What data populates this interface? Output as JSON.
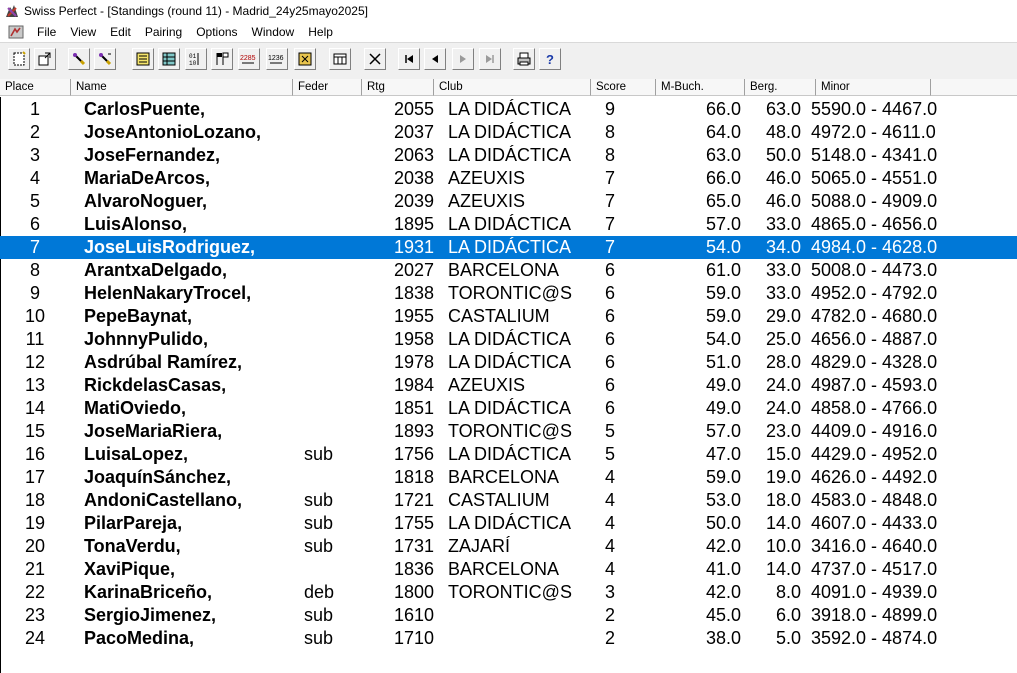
{
  "window": {
    "title": "Swiss Perfect - [Standings  (round 11) - Madrid_24y25mayo2025]"
  },
  "menu": {
    "items": [
      "File",
      "View",
      "Edit",
      "Pairing",
      "Options",
      "Window",
      "Help"
    ]
  },
  "toolbar": {
    "buttons": [
      "new-document-icon",
      "open-document-icon",
      "pairing-tool-icon",
      "pairing-alt-icon",
      "notes-icon",
      "standings-icon",
      "binary-crosstable-icon",
      "flags-icon",
      "numbers-2285-icon",
      "numbers-1236-icon",
      "export-icon",
      "table-icon",
      "cancel-icon",
      "first-record-icon",
      "previous-record-icon",
      "next-record-icon",
      "last-record-icon",
      "print-icon",
      "help-icon"
    ],
    "labels": {
      "n2285": "2285",
      "n1236": "1236"
    }
  },
  "colors": {
    "selection": "#0078d7",
    "toolbar": "#f0f0f0"
  },
  "standings": {
    "columns": [
      "Place",
      "Name",
      "Feder",
      "Rtg",
      "Club",
      "Score",
      "M-Buch.",
      "Berg.",
      "Minor"
    ],
    "selected_row": 6,
    "rows": [
      {
        "place": "1",
        "name": "CarlosPuente,",
        "feder": "",
        "rtg": "2055",
        "club": "LA DIDÁCTICA",
        "score": "9",
        "mbuch": "66.0",
        "berg": "63.0",
        "minor": "5590.0  -  4467.0"
      },
      {
        "place": "2",
        "name": "JoseAntonioLozano,",
        "feder": "",
        "rtg": "2037",
        "club": "LA DIDÁCTICA",
        "score": "8",
        "mbuch": "64.0",
        "berg": "48.0",
        "minor": "4972.0  -  4611.0"
      },
      {
        "place": "3",
        "name": "JoseFernandez,",
        "feder": "",
        "rtg": "2063",
        "club": "LA DIDÁCTICA",
        "score": "8",
        "mbuch": "63.0",
        "berg": "50.0",
        "minor": "5148.0  -  4341.0"
      },
      {
        "place": "4",
        "name": "MariaDeArcos,",
        "feder": "",
        "rtg": "2038",
        "club": "AZEUXIS",
        "score": "7",
        "mbuch": "66.0",
        "berg": "46.0",
        "minor": "5065.0  -  4551.0"
      },
      {
        "place": "5",
        "name": "AlvaroNoguer,",
        "feder": "",
        "rtg": "2039",
        "club": "AZEUXIS",
        "score": "7",
        "mbuch": "65.0",
        "berg": "46.0",
        "minor": "5088.0  -  4909.0"
      },
      {
        "place": "6",
        "name": "LuisAlonso,",
        "feder": "",
        "rtg": "1895",
        "club": "LA DIDÁCTICA",
        "score": "7",
        "mbuch": "57.0",
        "berg": "33.0",
        "minor": "4865.0  -  4656.0"
      },
      {
        "place": "7",
        "name": "JoseLuisRodriguez,",
        "feder": "",
        "rtg": "1931",
        "club": "LA DIDÁCTICA",
        "score": "7",
        "mbuch": "54.0",
        "berg": "34.0",
        "minor": "4984.0  -  4628.0"
      },
      {
        "place": "8",
        "name": "ArantxaDelgado,",
        "feder": "",
        "rtg": "2027",
        "club": "BARCELONA",
        "score": "6",
        "mbuch": "61.0",
        "berg": "33.0",
        "minor": "5008.0  -  4473.0"
      },
      {
        "place": "9",
        "name": "HelenNakaryTrocel,",
        "feder": "",
        "rtg": "1838",
        "club": "TORONTIC@S",
        "score": "6",
        "mbuch": "59.0",
        "berg": "33.0",
        "minor": "4952.0  -  4792.0"
      },
      {
        "place": "10",
        "name": "PepeBaynat,",
        "feder": "",
        "rtg": "1955",
        "club": "CASTALIUM",
        "score": "6",
        "mbuch": "59.0",
        "berg": "29.0",
        "minor": "4782.0  -  4680.0"
      },
      {
        "place": "11",
        "name": "JohnnyPulido,",
        "feder": "",
        "rtg": "1958",
        "club": "LA DIDÁCTICA",
        "score": "6",
        "mbuch": "54.0",
        "berg": "25.0",
        "minor": "4656.0  -  4887.0"
      },
      {
        "place": "12",
        "name": "Asdrúbal Ramírez,",
        "feder": "",
        "rtg": "1978",
        "club": "LA DIDÁCTICA",
        "score": "6",
        "mbuch": "51.0",
        "berg": "28.0",
        "minor": "4829.0  -  4328.0"
      },
      {
        "place": "13",
        "name": "RickdelasCasas,",
        "feder": "",
        "rtg": "1984",
        "club": "AZEUXIS",
        "score": "6",
        "mbuch": "49.0",
        "berg": "24.0",
        "minor": "4987.0  -  4593.0"
      },
      {
        "place": "14",
        "name": "MatiOviedo,",
        "feder": "",
        "rtg": "1851",
        "club": "LA DIDÁCTICA",
        "score": "6",
        "mbuch": "49.0",
        "berg": "24.0",
        "minor": "4858.0  -  4766.0"
      },
      {
        "place": "15",
        "name": "JoseMariaRiera,",
        "feder": "",
        "rtg": "1893",
        "club": "TORONTIC@S",
        "score": "5",
        "mbuch": "57.0",
        "berg": "23.0",
        "minor": "4409.0  -  4916.0"
      },
      {
        "place": "16",
        "name": "LuisaLopez,",
        "feder": "sub",
        "rtg": "1756",
        "club": "LA DIDÁCTICA",
        "score": "5",
        "mbuch": "47.0",
        "berg": "15.0",
        "minor": "4429.0  -  4952.0"
      },
      {
        "place": "17",
        "name": "JoaquínSánchez,",
        "feder": "",
        "rtg": "1818",
        "club": "BARCELONA",
        "score": "4",
        "mbuch": "59.0",
        "berg": "19.0",
        "minor": "4626.0  -  4492.0"
      },
      {
        "place": "18",
        "name": "AndoniCastellano,",
        "feder": "sub",
        "rtg": "1721",
        "club": "CASTALIUM",
        "score": "4",
        "mbuch": "53.0",
        "berg": "18.0",
        "minor": "4583.0  -  4848.0"
      },
      {
        "place": "19",
        "name": "PilarPareja,",
        "feder": "sub",
        "rtg": "1755",
        "club": "LA DIDÁCTICA",
        "score": "4",
        "mbuch": "50.0",
        "berg": "14.0",
        "minor": "4607.0  -  4433.0"
      },
      {
        "place": "20",
        "name": "TonaVerdu,",
        "feder": "sub",
        "rtg": "1731",
        "club": "ZAJARÍ",
        "score": "4",
        "mbuch": "42.0",
        "berg": "10.0",
        "minor": "3416.0  -  4640.0"
      },
      {
        "place": "21",
        "name": "XaviPique,",
        "feder": "",
        "rtg": "1836",
        "club": "BARCELONA",
        "score": "4",
        "mbuch": "41.0",
        "berg": "14.0",
        "minor": "4737.0  -  4517.0"
      },
      {
        "place": "22",
        "name": "KarinaBriceño,",
        "feder": "deb",
        "rtg": "1800",
        "club": "TORONTIC@S",
        "score": "3",
        "mbuch": "42.0",
        "berg": "8.0",
        "minor": "4091.0  -  4939.0"
      },
      {
        "place": "23",
        "name": "SergioJimenez,",
        "feder": "sub",
        "rtg": "1610",
        "club": "",
        "score": "2",
        "mbuch": "45.0",
        "berg": "6.0",
        "minor": "3918.0  -  4899.0"
      },
      {
        "place": "24",
        "name": "PacoMedina,",
        "feder": "sub",
        "rtg": "1710",
        "club": "",
        "score": "2",
        "mbuch": "38.0",
        "berg": "5.0",
        "minor": "3592.0  -  4874.0"
      }
    ]
  }
}
